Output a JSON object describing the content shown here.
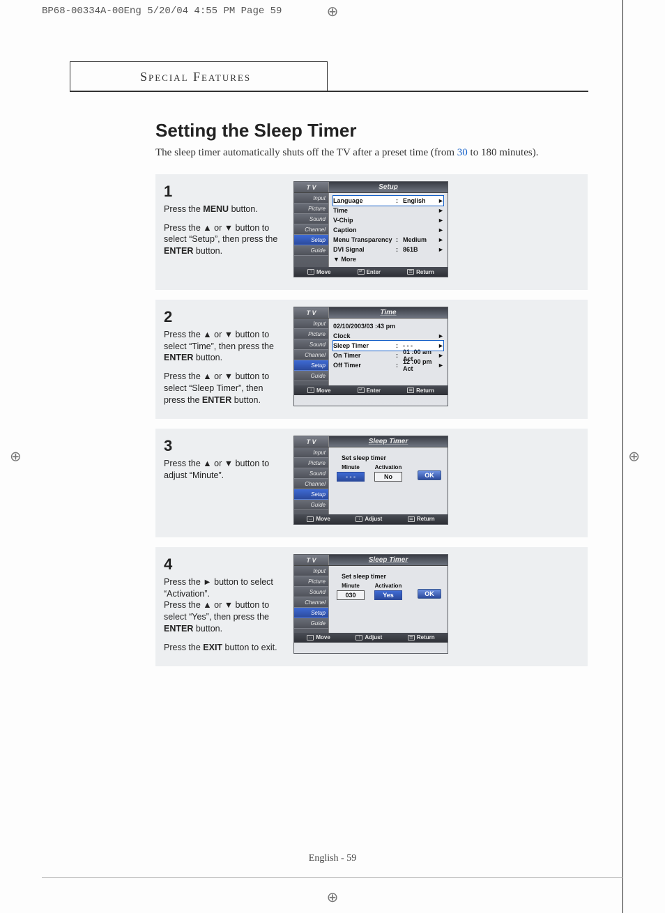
{
  "slug": "BP68-00334A-00Eng  5/20/04  4:55 PM  Page 59",
  "section_tab": "Special Features",
  "page_title": "Setting the Sleep Timer",
  "intro_pre": "The sleep timer automatically shuts off the TV after a preset time (from ",
  "intro_highlight": "30",
  "intro_post": " to 180 minutes).",
  "footer": "English - 59",
  "sidebar_items": [
    "Input",
    "Picture",
    "Sound",
    "Channel",
    "Setup",
    "Guide"
  ],
  "steps": [
    {
      "num": "1",
      "text_parts": [
        "Press the <b>MENU</b> button.",
        "Press the ▲ or ▼ button to select “Setup”, then press the <b>ENTER</b> button."
      ],
      "screen": {
        "tv": "T V",
        "title": "Setup",
        "active_sidebar": "Setup",
        "rows": [
          {
            "label": "Language",
            "value": "English",
            "arrow": "►",
            "selected": true
          },
          {
            "label": "Time",
            "value": "",
            "arrow": "►"
          },
          {
            "label": "V-Chip",
            "value": "",
            "arrow": "►"
          },
          {
            "label": "Caption",
            "value": "",
            "arrow": "►"
          },
          {
            "label": "Menu Transparency",
            "value": "Medium",
            "arrow": "►"
          },
          {
            "label": "DVI Signal",
            "value": "861B",
            "arrow": "►"
          },
          {
            "label": "▼ More",
            "value": "",
            "arrow": ""
          }
        ],
        "footer": [
          {
            "icon": "↕",
            "label": "Move"
          },
          {
            "icon": "↵",
            "label": "Enter"
          },
          {
            "icon": "☰",
            "label": "Return"
          }
        ]
      }
    },
    {
      "num": "2",
      "text_parts": [
        "Press the ▲ or ▼ button to select “Time”, then press the <b>ENTER</b> button.",
        "Press the ▲ or ▼ button to select “Sleep Timer”, then press the <b>ENTER</b> button."
      ],
      "screen": {
        "tv": "T V",
        "title": "Time",
        "active_sidebar": "Setup",
        "rows": [
          {
            "label": "02/10/2003/03 :43  pm",
            "value": "",
            "arrow": "",
            "full": true
          },
          {
            "label": "Clock",
            "value": "",
            "arrow": "►"
          },
          {
            "label": "Sleep Timer",
            "value": "- - -",
            "arrow": "►",
            "selected": true
          },
          {
            "label": "On Timer",
            "value": "01 :00  am Act",
            "arrow": "►"
          },
          {
            "label": "Off Timer",
            "value": "12 :00  pm Act",
            "arrow": "►"
          }
        ],
        "footer": [
          {
            "icon": "↕",
            "label": "Move"
          },
          {
            "icon": "↵",
            "label": "Enter"
          },
          {
            "icon": "☰",
            "label": "Return"
          }
        ]
      }
    },
    {
      "num": "3",
      "text_parts": [
        "Press the ▲ or ▼ button to adjust “Minute”."
      ],
      "screen": {
        "tv": "T V",
        "title": "Sleep Timer",
        "active_sidebar": "Setup",
        "sleep": {
          "caption": "Set sleep timer",
          "col1_label": "Minute",
          "col2_label": "Activation",
          "minute": "- - -",
          "activation": "No",
          "minute_active": true,
          "activation_active": false,
          "ok": "OK"
        },
        "footer": [
          {
            "icon": "↔",
            "label": "Move"
          },
          {
            "icon": "↕",
            "label": "Adjust"
          },
          {
            "icon": "☰",
            "label": "Return"
          }
        ]
      }
    },
    {
      "num": "4",
      "text_parts": [
        "Press the ► button to select “Activation”.<br>Press the ▲ or ▼ button to select “Yes”, then press the <b>ENTER</b> button.",
        "Press the <b>EXIT</b> button to exit."
      ],
      "screen": {
        "tv": "T V",
        "title": "Sleep Timer",
        "active_sidebar": "Setup",
        "sleep": {
          "caption": "Set sleep timer",
          "col1_label": "Minute",
          "col2_label": "Activation",
          "minute": "030",
          "activation": "Yes",
          "minute_active": false,
          "activation_active": true,
          "ok": "OK"
        },
        "footer": [
          {
            "icon": "↔",
            "label": "Move"
          },
          {
            "icon": "↕",
            "label": "Adjust"
          },
          {
            "icon": "☰",
            "label": "Return"
          }
        ]
      }
    }
  ]
}
